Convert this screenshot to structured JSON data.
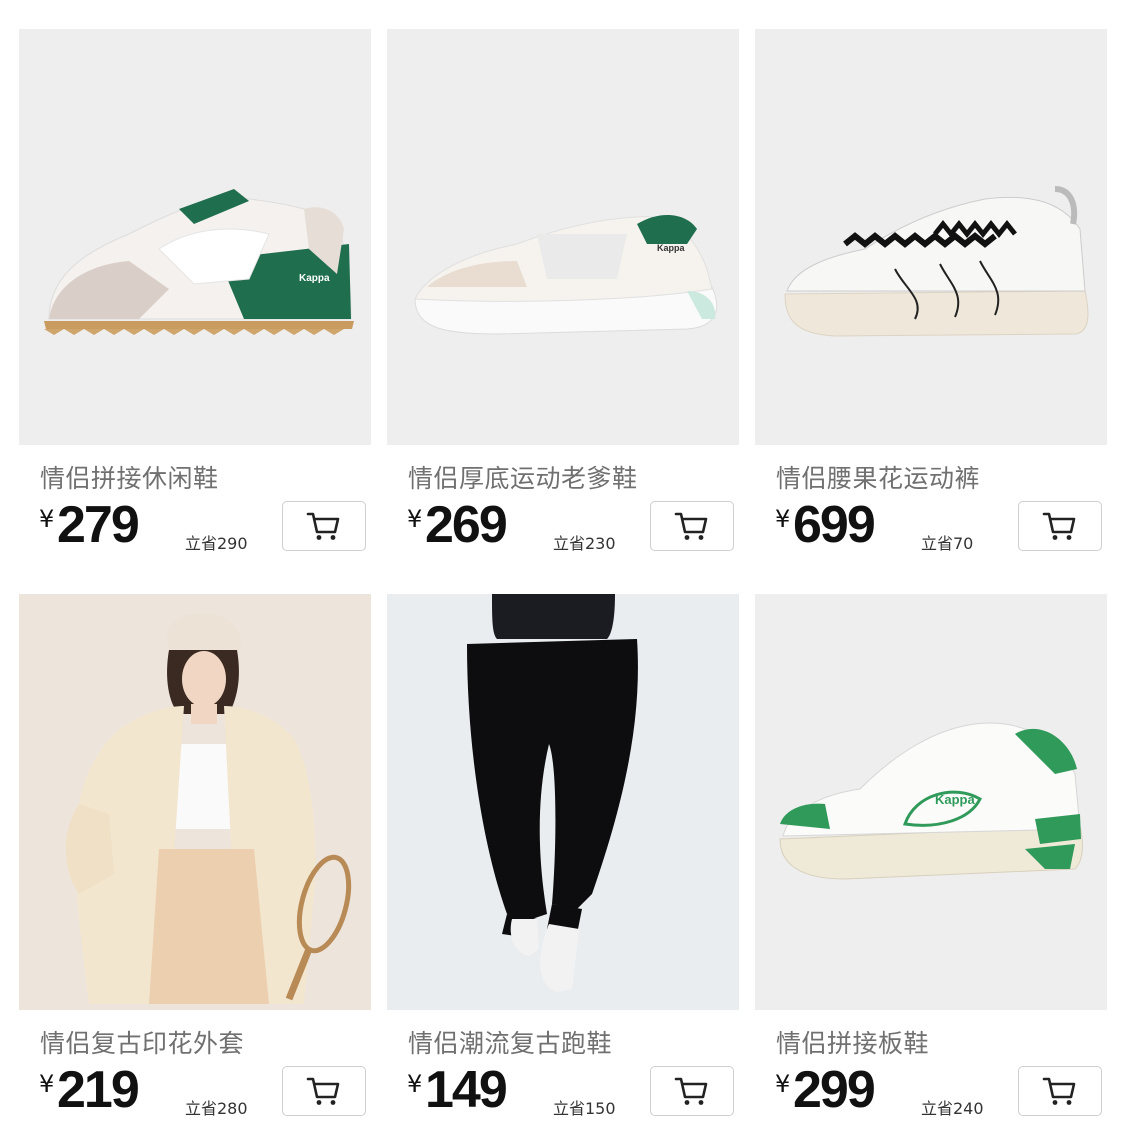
{
  "products": [
    {
      "title": "情侣拼接休闲鞋",
      "currency": "¥",
      "price": "279",
      "saving": "立省290",
      "image": "shoe-retro-green"
    },
    {
      "title": "情侣厚底运动老爹鞋",
      "currency": "¥",
      "price": "269",
      "saving": "立省230",
      "image": "shoe-chunky-white"
    },
    {
      "title": "情侣腰果花运动裤",
      "currency": "¥",
      "price": "699",
      "saving": "立省70",
      "image": "shoe-zigzag-lace"
    },
    {
      "title": "情侣复古印花外套",
      "currency": "¥",
      "price": "219",
      "saving": "立省280",
      "image": "model-cream-jacket"
    },
    {
      "title": "情侣潮流复古跑鞋",
      "currency": "¥",
      "price": "149",
      "saving": "立省150",
      "image": "model-black-pants"
    },
    {
      "title": "情侣拼接板鞋",
      "currency": "¥",
      "price": "299",
      "saving": "立省240",
      "image": "shoe-court-green"
    }
  ],
  "colors": {
    "accent_green": "#1f6e4e",
    "title_gray": "#707070",
    "price_black": "#111111",
    "card_bg": "#eeeeee"
  },
  "icons": {
    "cart": "shopping-cart-icon"
  }
}
